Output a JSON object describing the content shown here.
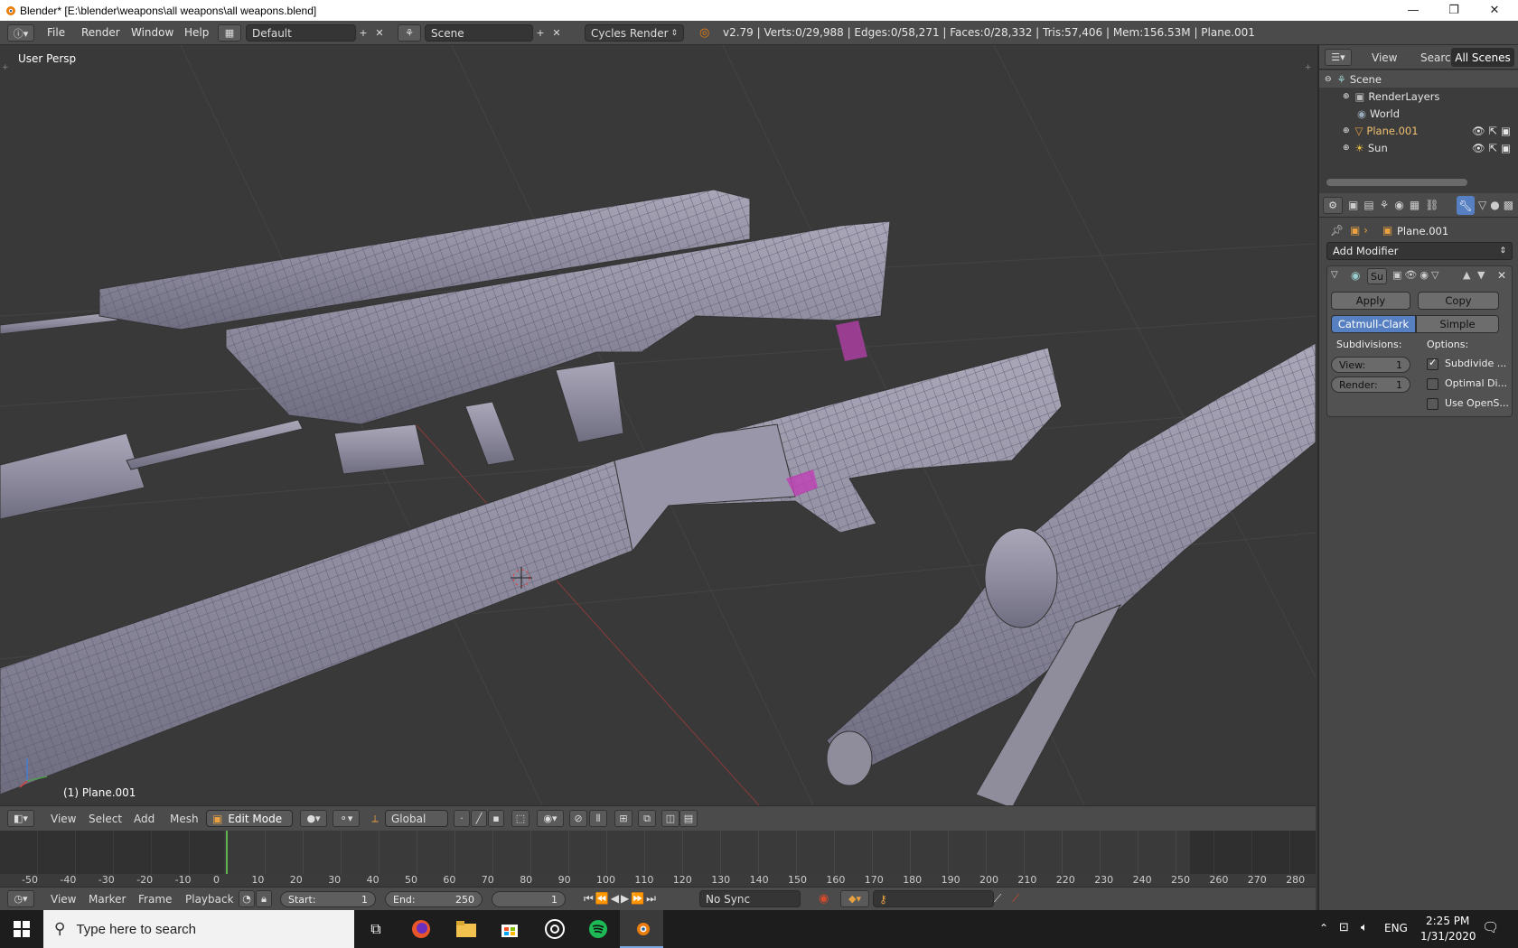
{
  "window": {
    "title": "Blender* [E:\\blender\\weapons\\all weapons\\all weapons.blend]",
    "minimize": "—",
    "maximize": "❐",
    "close": "✕"
  },
  "infobar": {
    "menus": [
      "File",
      "Render",
      "Window",
      "Help"
    ],
    "layout": "Default",
    "scene": "Scene",
    "engine": "Cycles Render",
    "stats": "v2.79 | Verts:0/29,988 | Edges:0/58,271 | Faces:0/28,332 | Tris:57,406 | Mem:156.53M | Plane.001"
  },
  "viewport": {
    "view_label": "User Persp",
    "object_label": "(1) Plane.001"
  },
  "vp_header": {
    "menus": [
      "View",
      "Select",
      "Add",
      "Mesh"
    ],
    "mode": "Edit Mode",
    "orientation": "Global"
  },
  "timeline": {
    "ruler": [
      "-50",
      "-40",
      "-30",
      "-20",
      "-10",
      "0",
      "10",
      "20",
      "30",
      "40",
      "50",
      "60",
      "70",
      "80",
      "90",
      "100",
      "110",
      "120",
      "130",
      "140",
      "150",
      "160",
      "170",
      "180",
      "190",
      "200",
      "210",
      "220",
      "230",
      "240",
      "250",
      "260",
      "270",
      "280"
    ],
    "menus": [
      "View",
      "Marker",
      "Frame",
      "Playback"
    ],
    "start_label": "Start:",
    "start_value": "1",
    "end_label": "End:",
    "end_value": "250",
    "current_frame": "1",
    "sync": "No Sync"
  },
  "outliner": {
    "tabs": [
      "View",
      "Search",
      "All Scenes"
    ],
    "items": [
      {
        "label": "Scene"
      },
      {
        "label": "RenderLayers"
      },
      {
        "label": "World"
      },
      {
        "label": "Plane.001"
      },
      {
        "label": "Sun"
      }
    ]
  },
  "properties": {
    "object_name": "Plane.001",
    "add_modifier": "Add Modifier",
    "modifier_name": "Su",
    "apply": "Apply",
    "copy": "Copy",
    "catmull": "Catmull-Clark",
    "simple": "Simple",
    "subdivisions_label": "Subdivisions:",
    "options_label": "Options:",
    "view_label": "View:",
    "view_value": "1",
    "render_label": "Render:",
    "render_value": "1",
    "opt1": "Subdivide ...",
    "opt2": "Optimal Di...",
    "opt3": "Use OpenS..."
  },
  "taskbar": {
    "search_placeholder": "Type here to search",
    "lang": "ENG",
    "time": "2:25 PM",
    "date": "1/31/2020"
  },
  "colors": {
    "accent_blue": "#5680c2",
    "mesh": "#8f8d9c",
    "ui_dark": "#393939"
  }
}
